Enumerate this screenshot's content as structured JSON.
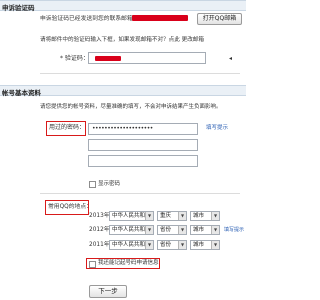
{
  "appeal_verification": {
    "section_title": "申诉验证码",
    "sent_notice": "申诉验证码已经发送到您的联系邮箱：",
    "open_mailbox_button": "打开QQ邮箱",
    "instruction": "请将邮件中的验证码输入下框，如果发现邮箱不对？点此 更改邮箱",
    "code_label": "* 验证码：",
    "code_value": ""
  },
  "account_info": {
    "section_title": "帐号基本资料",
    "intro": "请您提供您的帐号资料，尽量准确的填写，不会对申诉结果产生负面影响。",
    "password_label": "用过的密码：",
    "password_value": "••••••••••••••••••••",
    "fill_hint": "填写提示",
    "show_password_label": "显示密码",
    "locations_label": "常用QQ的地点：",
    "location_rows": [
      {
        "year": "2013年",
        "country": "中华人民共和国",
        "province": "重庆",
        "city": "城市"
      },
      {
        "year": "2012年",
        "country": "中华人民共和国",
        "province": "省份",
        "city": "城市"
      },
      {
        "year": "2011年",
        "country": "中华人民共和国",
        "province": "省份",
        "city": "城市"
      }
    ],
    "location_hint": "填写提示",
    "forgot_location_label": "我还能记起号码申请信息",
    "next_button": "下一步"
  },
  "colors": {
    "highlight": "#d81a1a",
    "link": "#2b5fb4",
    "section_bg": "#eaf0f6"
  }
}
